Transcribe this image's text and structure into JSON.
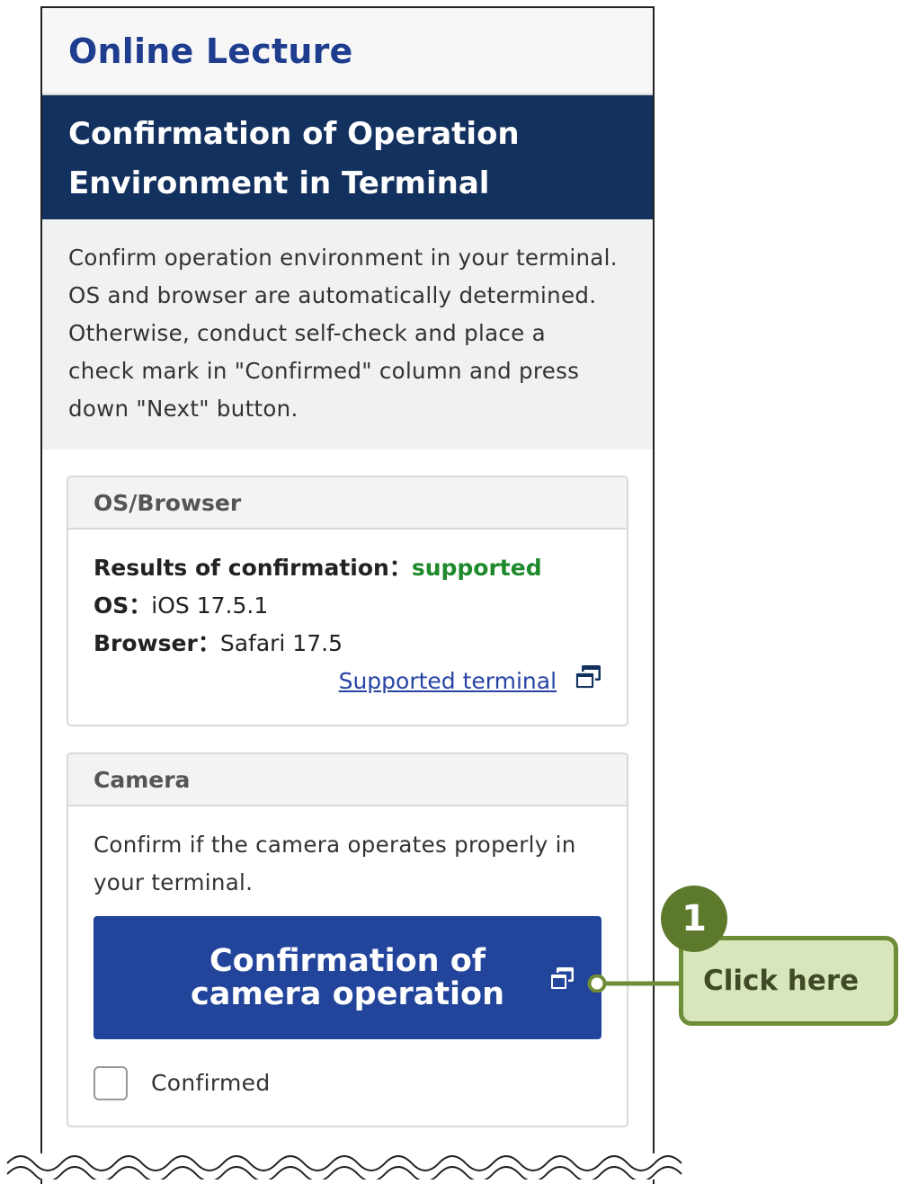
{
  "app": {
    "title": "Online Lecture"
  },
  "section": {
    "title_line1": "Confirmation of Operation",
    "title_line2": "Environment in Terminal"
  },
  "intro": {
    "lines": [
      "Confirm operation environment in your terminal.",
      "OS and browser are automatically determined.",
      "Otherwise, conduct self-check and place a",
      "check mark in \"Confirmed\" column and press",
      "down \"Next\" button."
    ]
  },
  "os_browser": {
    "header": "OS/Browser",
    "result_label": "Results of confirmation：",
    "result_value": "supported",
    "os_label": "OS：",
    "os_value": "iOS 17.5.1",
    "browser_label": "Browser：",
    "browser_value": "Safari 17.5",
    "link_label": "Supported terminal"
  },
  "camera": {
    "header": "Camera",
    "description_line1": "Confirm if the camera operates properly in",
    "description_line2": "your terminal.",
    "button_line1": "Confirmation of",
    "button_line2": "camera operation",
    "confirmed_label": "Confirmed"
  },
  "callout": {
    "step": "1",
    "text": "Click here"
  },
  "colors": {
    "app_title": "#1f3d8f",
    "section_bg": "#13315f",
    "button_bg": "#22449a",
    "status_ok": "#1e8a2c",
    "callout_bg": "#d8e6bc",
    "callout_border": "#6f8c36",
    "badge_bg": "#5d7a2c"
  },
  "icons": {
    "external_window": "external-window-icon"
  }
}
